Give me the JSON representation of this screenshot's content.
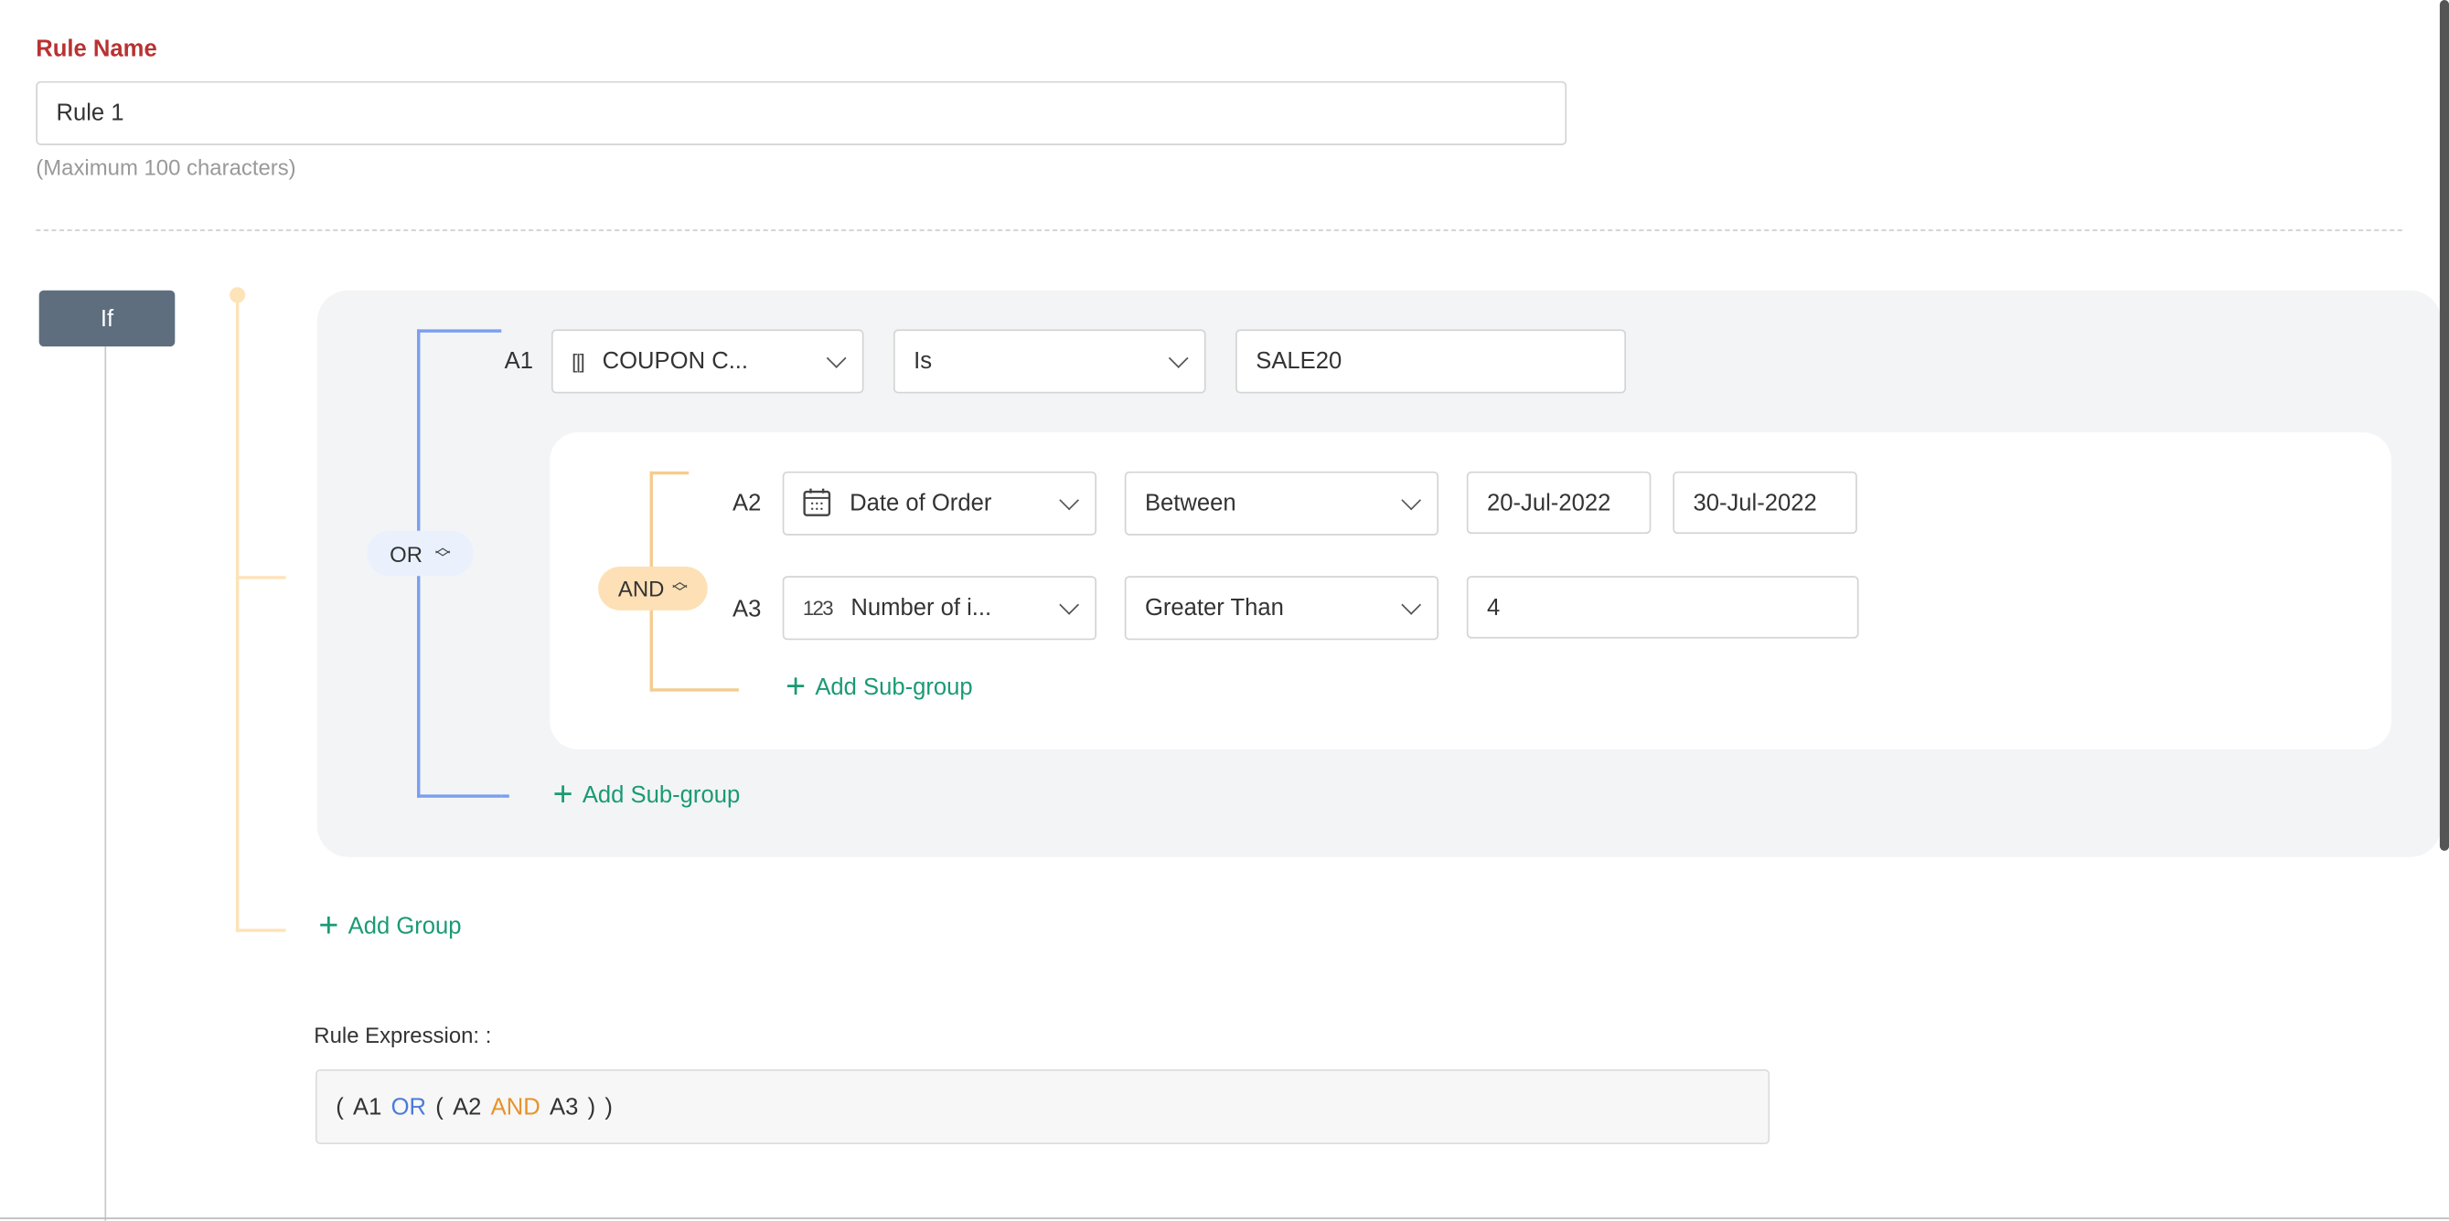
{
  "rule_name": {
    "label": "Rule Name",
    "value": "Rule 1",
    "helper": "(Maximum 100 characters)"
  },
  "if_label": "If",
  "colors": {
    "accent_green": "#1a9a74",
    "or_blue": "#4a7bd8",
    "and_orange": "#e8922b",
    "label_red": "#b83232",
    "if_bg": "#5e6e7e"
  },
  "group": {
    "operator": "OR",
    "conditions": [
      {
        "id": "A1",
        "field": "COUPON C...",
        "field_icon": "text-field-icon",
        "operator": "Is",
        "value": "SALE20"
      }
    ],
    "subgroup": {
      "operator": "AND",
      "conditions": [
        {
          "id": "A2",
          "field": "Date of Order",
          "field_icon": "calendar-icon",
          "operator": "Between",
          "value_from": "20-Jul-2022",
          "value_to": "30-Jul-2022"
        },
        {
          "id": "A3",
          "field": "Number of i...",
          "field_icon": "number-icon",
          "field_icon_text": "123",
          "operator": "Greater Than",
          "value": "4"
        }
      ],
      "add_subgroup": "Add Sub-group"
    },
    "add_subgroup": "Add Sub-group"
  },
  "add_group": "Add Group",
  "expression": {
    "label": "Rule Expression: :",
    "tokens": [
      "(",
      "A1",
      "OR",
      "(",
      "A2",
      "AND",
      "A3",
      ")",
      ")"
    ]
  }
}
